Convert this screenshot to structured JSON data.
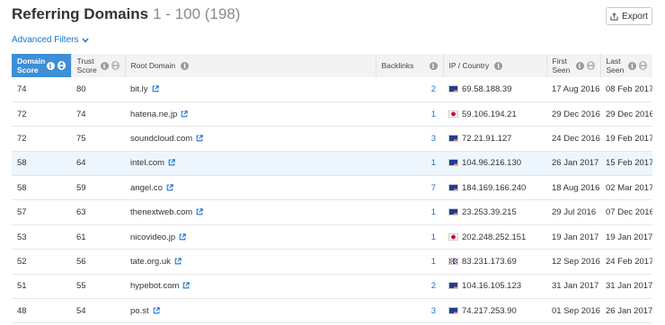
{
  "header": {
    "title": "Referring Domains",
    "range": "1 - 100 (198)"
  },
  "export_label": "Export",
  "filters_label": "Advanced Filters",
  "columns": {
    "domain_score_1": "Domain",
    "domain_score_2": "Score",
    "trust_score_1": "Trust",
    "trust_score_2": "Score",
    "root_domain": "Root Domain",
    "backlinks": "Backlinks",
    "ip_country": "IP / Country",
    "first_seen_1": "First",
    "first_seen_2": "Seen",
    "last_seen_1": "Last",
    "last_seen_2": "Seen"
  },
  "colors": {
    "accent": "#3d8fd6",
    "link": "#1a73c9",
    "highlight_row": "#eef6fd"
  },
  "rows": [
    {
      "domain_score": "74",
      "trust_score": "80",
      "root_domain": "bit.ly",
      "backlinks": "2",
      "country": "US",
      "ip": "69.58.188.39",
      "first_seen": "17 Aug 2016",
      "last_seen": "08 Feb 2017"
    },
    {
      "domain_score": "72",
      "trust_score": "74",
      "root_domain": "hatena.ne.jp",
      "backlinks": "1",
      "country": "JP",
      "ip": "59.106.194.21",
      "first_seen": "29 Dec 2016",
      "last_seen": "29 Dec 2016"
    },
    {
      "domain_score": "72",
      "trust_score": "75",
      "root_domain": "soundcloud.com",
      "backlinks": "3",
      "country": "US",
      "ip": "72.21.91.127",
      "first_seen": "24 Dec 2016",
      "last_seen": "19 Feb 2017"
    },
    {
      "domain_score": "58",
      "trust_score": "64",
      "root_domain": "intel.com",
      "backlinks": "1",
      "country": "US",
      "ip": "104.96.216.130",
      "first_seen": "26 Jan 2017",
      "last_seen": "15 Feb 2017"
    },
    {
      "domain_score": "58",
      "trust_score": "59",
      "root_domain": "angel.co",
      "backlinks": "7",
      "country": "US",
      "ip": "184.169.166.240",
      "first_seen": "18 Aug 2016",
      "last_seen": "02 Mar 2017"
    },
    {
      "domain_score": "57",
      "trust_score": "63",
      "root_domain": "thenextweb.com",
      "backlinks": "1",
      "country": "US",
      "ip": "23.253.39.215",
      "first_seen": "29 Jul 2016",
      "last_seen": "07 Dec 2016"
    },
    {
      "domain_score": "53",
      "trust_score": "61",
      "root_domain": "nicovideo.jp",
      "backlinks": "1",
      "country": "JP",
      "ip": "202.248.252.151",
      "first_seen": "19 Jan 2017",
      "last_seen": "19 Jan 2017"
    },
    {
      "domain_score": "52",
      "trust_score": "56",
      "root_domain": "tate.org.uk",
      "backlinks": "1",
      "country": "UK",
      "ip": "83.231.173.69",
      "first_seen": "12 Sep 2016",
      "last_seen": "24 Feb 2017"
    },
    {
      "domain_score": "51",
      "trust_score": "55",
      "root_domain": "hypebot.com",
      "backlinks": "2",
      "country": "US",
      "ip": "104.16.105.123",
      "first_seen": "31 Jan 2017",
      "last_seen": "31 Jan 2017"
    },
    {
      "domain_score": "48",
      "trust_score": "54",
      "root_domain": "po.st",
      "backlinks": "3",
      "country": "US",
      "ip": "74.217.253.90",
      "first_seen": "01 Sep 2016",
      "last_seen": "26 Jan 2017"
    }
  ]
}
